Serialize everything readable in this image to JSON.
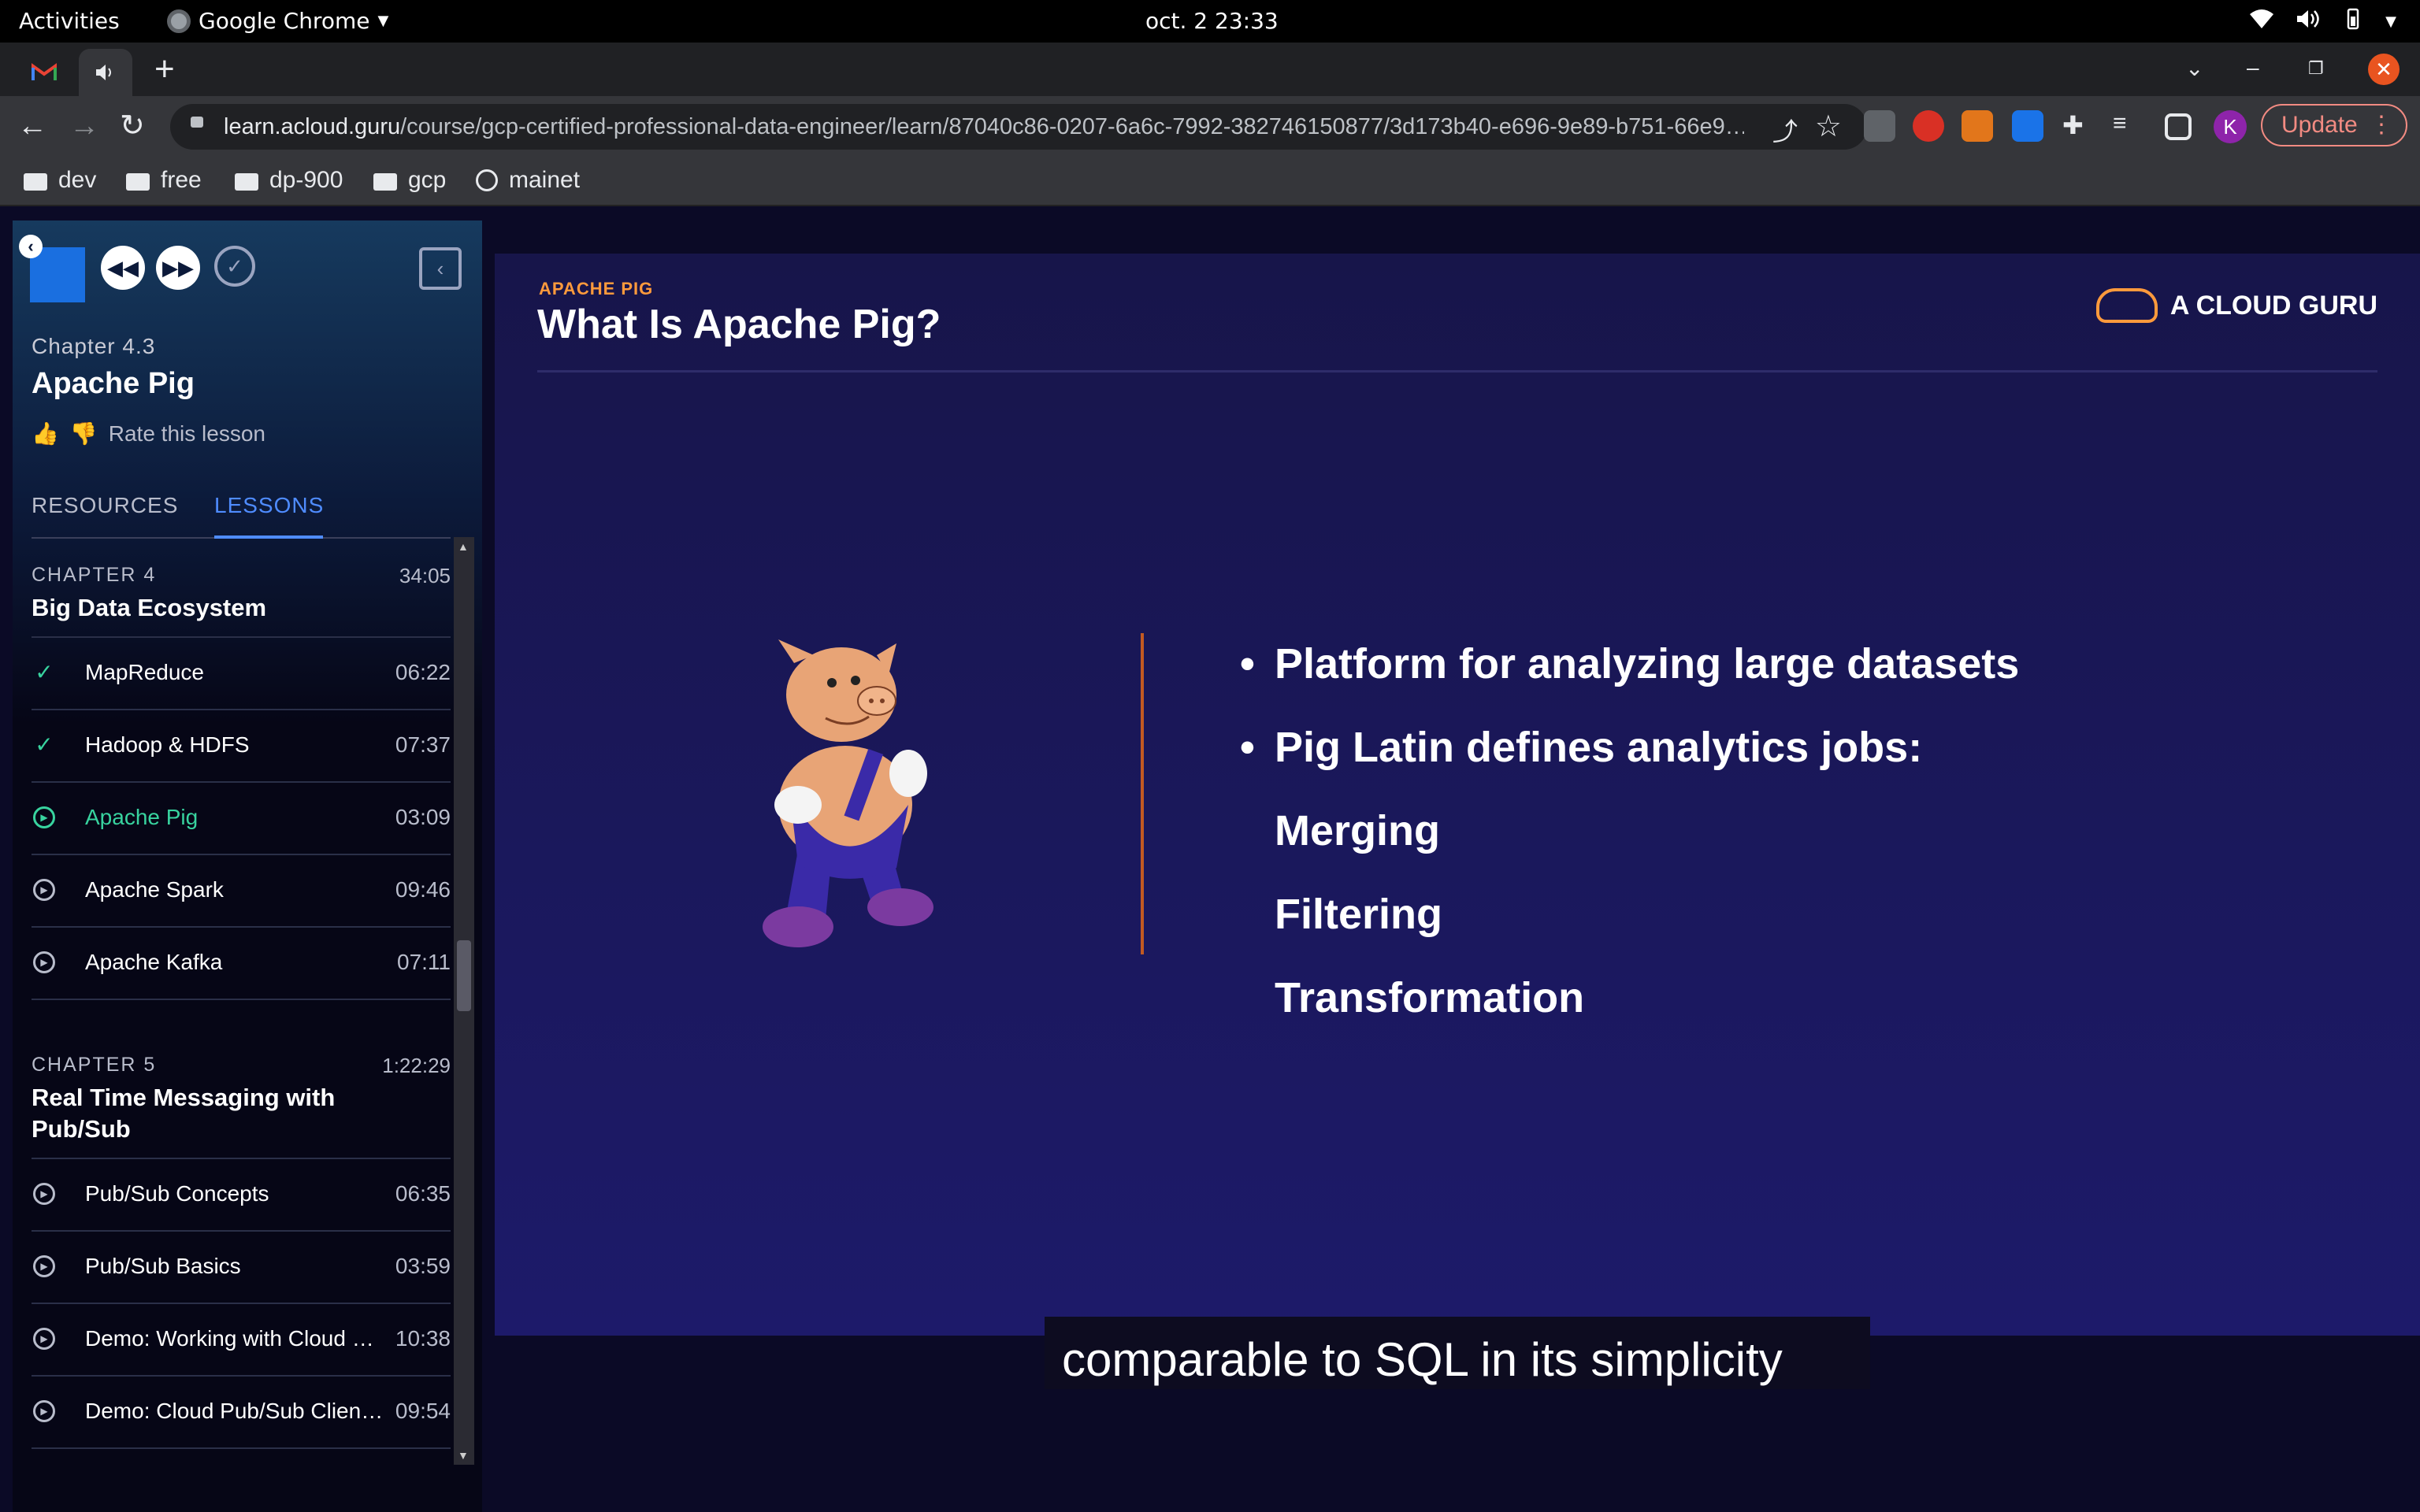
{
  "system_bar": {
    "activities": "Activities",
    "app_name": "Google Chrome",
    "clock": "oct. 2  23:33"
  },
  "browser": {
    "url_host": "learn.acloud.guru",
    "url_path": "/course/gcp-certified-professional-data-engineer/learn/87040c86-0207-6a6c-7992-382746150877/3d173b40-e696-9e89-b751-66e9…",
    "avatar_letter": "K",
    "update_label": "Update",
    "bookmarks": [
      "dev",
      "free",
      "dp-900",
      "gcp",
      "mainet"
    ]
  },
  "sidebar": {
    "chapter_label": "Chapter 4.3",
    "lesson_title": "Apache Pig",
    "rate_label": "Rate this lesson",
    "tabs": {
      "resources": "RESOURCES",
      "lessons": "LESSONS"
    },
    "chapters": [
      {
        "label": "CHAPTER 4",
        "duration": "34:05",
        "name": "Big Data Ecosystem",
        "lessons": [
          {
            "name": "MapReduce",
            "duration": "06:22",
            "status": "completed"
          },
          {
            "name": "Hadoop & HDFS",
            "duration": "07:37",
            "status": "completed"
          },
          {
            "name": "Apache Pig",
            "duration": "03:09",
            "status": "current"
          },
          {
            "name": "Apache Spark",
            "duration": "09:46",
            "status": "not-started"
          },
          {
            "name": "Apache Kafka",
            "duration": "07:11",
            "status": "not-started"
          }
        ]
      },
      {
        "label": "CHAPTER 5",
        "duration": "1:22:29",
        "name": "Real Time Messaging with Pub/Sub",
        "lessons": [
          {
            "name": "Pub/Sub Concepts",
            "duration": "06:35",
            "status": "not-started"
          },
          {
            "name": "Pub/Sub Basics",
            "duration": "03:59",
            "status": "not-started"
          },
          {
            "name": "Demo: Working with Cloud …",
            "duration": "10:38",
            "status": "not-started"
          },
          {
            "name": "Demo: Cloud Pub/Sub Clien…",
            "duration": "09:54",
            "status": "not-started"
          }
        ]
      }
    ]
  },
  "slide": {
    "kicker": "APACHE PIG",
    "title": "What Is Apache Pig?",
    "brand": "A CLOUD GURU",
    "bullets": [
      {
        "text": "Platform for analyzing large datasets",
        "bullet": true
      },
      {
        "text": "Pig Latin defines analytics jobs:",
        "bullet": true
      },
      {
        "text": "Merging",
        "bullet": false
      },
      {
        "text": "Filtering",
        "bullet": false
      },
      {
        "text": "Transformation",
        "bullet": false
      }
    ],
    "accent_color": "#ff9a3c"
  },
  "caption": "comparable to SQL in its simplicity"
}
